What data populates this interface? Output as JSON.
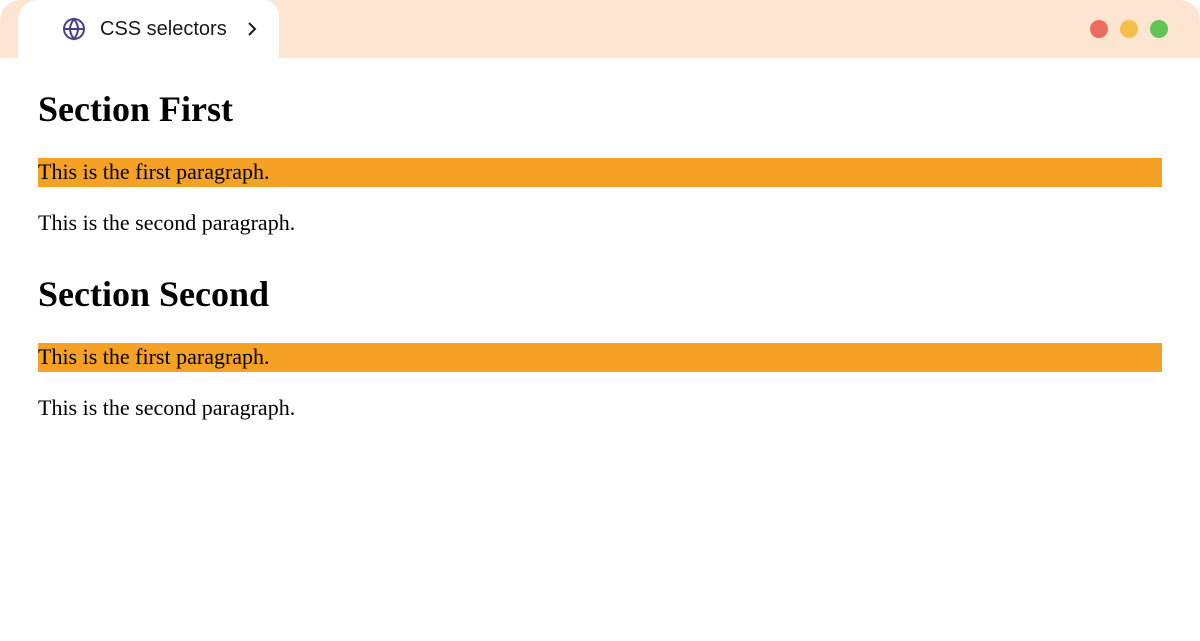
{
  "tab": {
    "title": "CSS selectors"
  },
  "sections": {
    "first": {
      "heading": "Section First",
      "p1": "This is the first paragraph.",
      "p2": "This is the second paragraph."
    },
    "second": {
      "heading": "Section Second",
      "p1": "This is the first paragraph.",
      "p2": "This is the second paragraph."
    }
  },
  "colors": {
    "highlight": "#f5a125",
    "chrome_bg": "#fce6d2"
  }
}
